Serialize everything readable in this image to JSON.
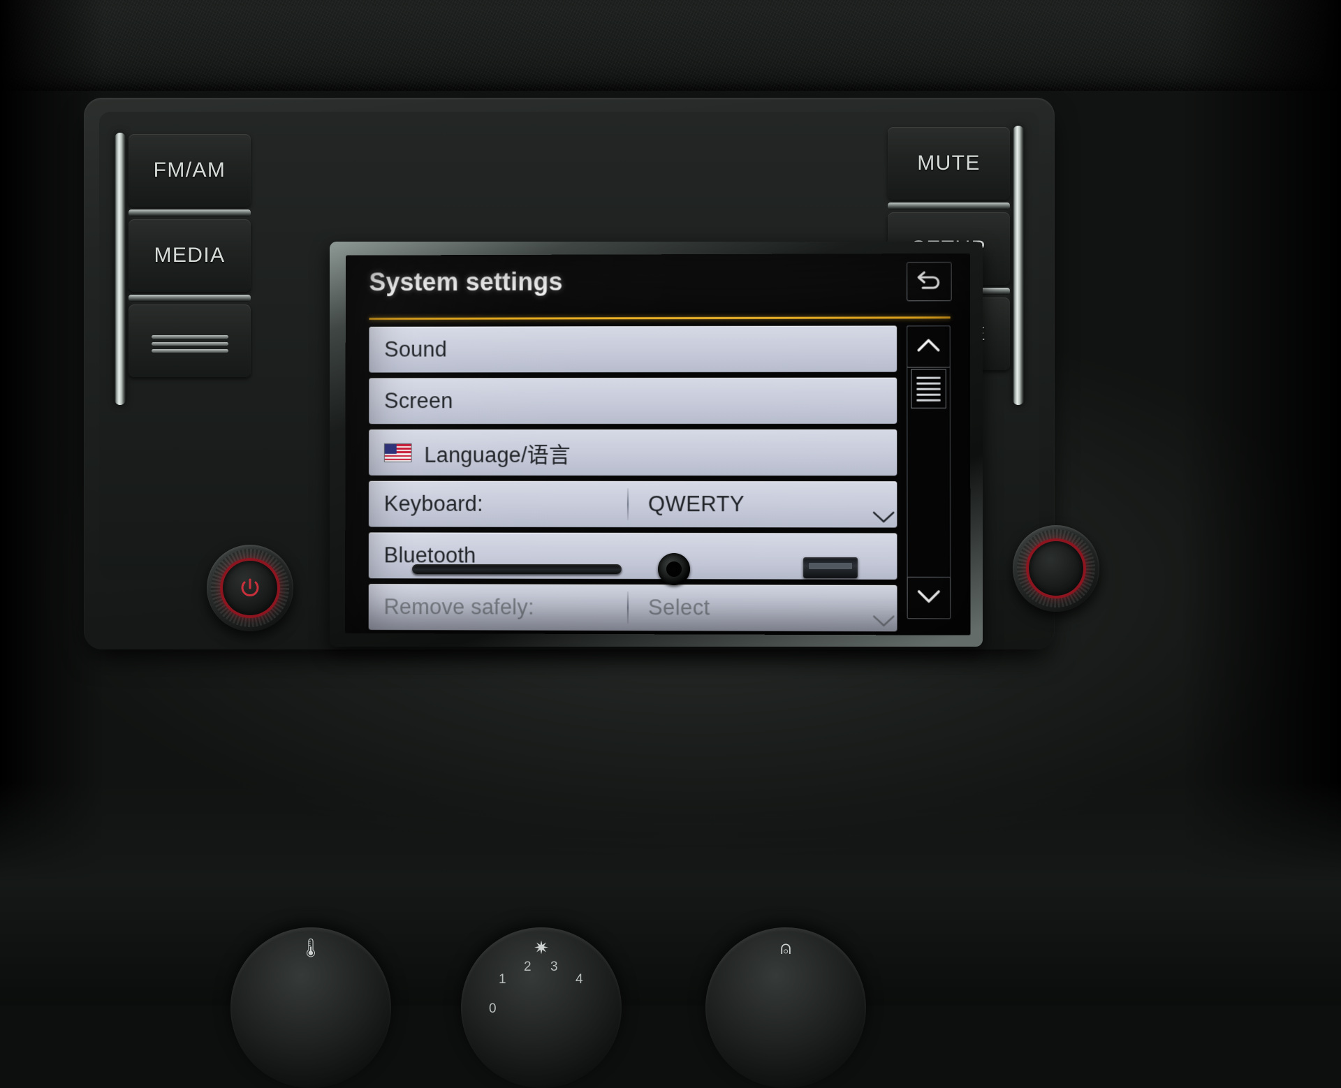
{
  "hardkeys": {
    "left": [
      {
        "label": "FM/AM",
        "name": "fm-am-button"
      },
      {
        "label": "MEDIA",
        "name": "media-button"
      }
    ],
    "right": [
      {
        "label": "MUTE",
        "name": "mute-button"
      },
      {
        "label": "SETUP",
        "name": "setup-button"
      },
      {
        "label": "PHONE",
        "name": "phone-button"
      }
    ]
  },
  "screen": {
    "title": "System settings",
    "accent_color": "#e3a81c",
    "row_bg_color": "#c9cddc",
    "back_icon": "back-arrow-icon",
    "rows": [
      {
        "label": "Sound",
        "value": "",
        "type": "nav",
        "icon": "",
        "disabled": false
      },
      {
        "label": "Screen",
        "value": "",
        "type": "nav",
        "icon": "",
        "disabled": false
      },
      {
        "label": "Language/语言",
        "value": "",
        "type": "nav",
        "icon": "us-flag-icon",
        "disabled": false
      },
      {
        "label": "Keyboard:",
        "value": "QWERTY",
        "type": "dropdown",
        "icon": "",
        "disabled": false
      },
      {
        "label": "Bluetooth",
        "value": "",
        "type": "nav",
        "icon": "",
        "disabled": false
      },
      {
        "label": "Remove safely:",
        "value": "Select",
        "type": "dropdown",
        "icon": "",
        "disabled": true
      }
    ],
    "scrollbar": {
      "up_icon": "chevron-up-icon",
      "down_icon": "chevron-down-icon",
      "thumb_icon": "scroll-thumb-handle"
    }
  },
  "hvac": {
    "dial_left_icon": "temperature-icon",
    "dial_center_icon": "fan-icon",
    "dial_right_icon": "defrost-icon",
    "center_marks": [
      "0",
      "1",
      "2",
      "3",
      "4"
    ]
  }
}
